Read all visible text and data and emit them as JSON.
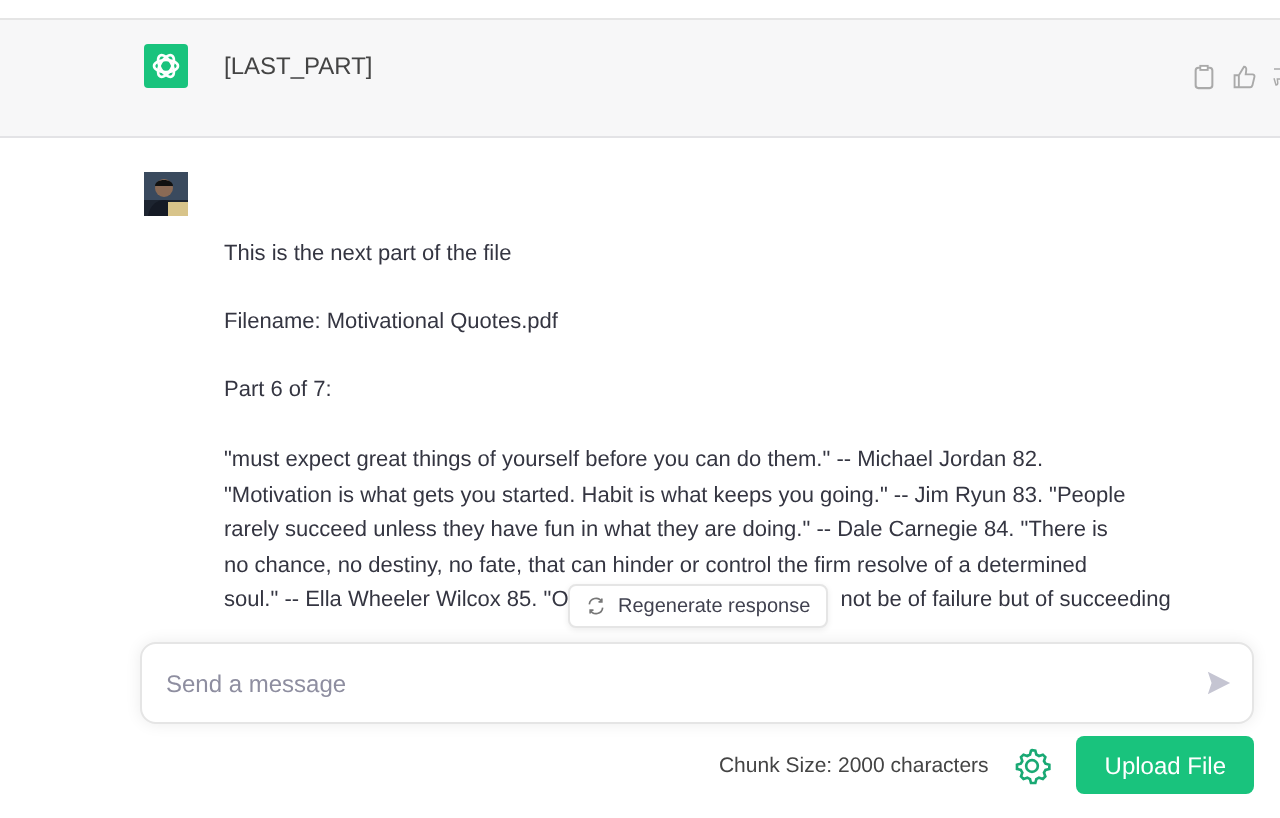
{
  "assistant_message": {
    "text": "[LAST_PART]"
  },
  "user_message": {
    "avatar": {
      "kind": "picture"
    },
    "paragraphs": [
      "This is the next part of the file",
      "Filename: Motivational Quotes.pdf",
      "Part 6 of 7:"
    ],
    "quote_lines": [
      [
        "\"must expect great things of yourself before you can do them.\" -- Michael Jordan  82."
      ],
      [
        "\"Motivation is what gets you started. Habit is what keeps you going.\" -- Jim Ryun  83. \"People"
      ],
      [
        "rarely succeed unless they have fun in what they are doing.\" -- Dale Carnegie  84. \"There is"
      ],
      [
        "no chance, no destiny, no fate, that can hinder or control the firm resolve of a determined"
      ],
      [
        "soul.\" -- Ella Wheeler Wilcox  85. \"O",
        "not be of failure but of succeeding"
      ]
    ]
  },
  "regenerate_button": {
    "label": "Regenerate response"
  },
  "composer": {
    "placeholder": "Send a message"
  },
  "footer": {
    "chunk_size": "Chunk Size: 2000 characters",
    "upload_button": "Upload File"
  }
}
